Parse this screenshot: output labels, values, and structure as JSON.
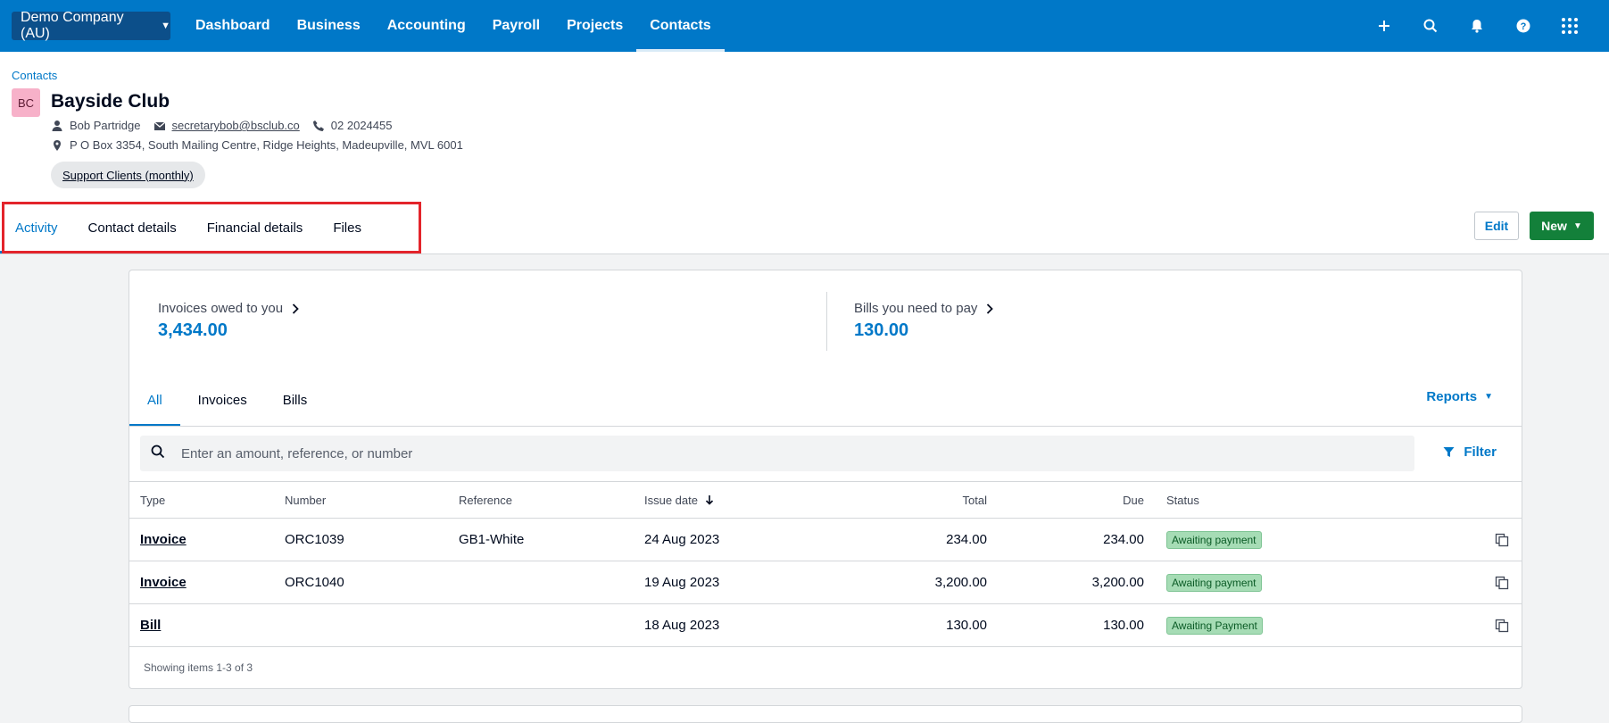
{
  "topbar": {
    "org_name": "Demo Company (AU)",
    "nav": [
      "Dashboard",
      "Business",
      "Accounting",
      "Payroll",
      "Projects",
      "Contacts"
    ],
    "active_nav": "Contacts",
    "icons": [
      "plus-icon",
      "search-icon",
      "bell-icon",
      "help-icon",
      "apps-grid-icon"
    ]
  },
  "header": {
    "breadcrumb": "Contacts",
    "avatar_initials": "BC",
    "contact_name": "Bayside Club",
    "person": "Bob Partridge",
    "email": "secretarybob@bsclub.co",
    "phone": "02 2024455",
    "address": "P O Box 3354, South Mailing Centre, Ridge Heights, Madeupville, MVL 6001",
    "group": "Support Clients (monthly)",
    "tabs": [
      "Activity",
      "Contact details",
      "Financial details",
      "Files"
    ],
    "active_tab": "Activity",
    "edit_label": "Edit",
    "new_label": "New"
  },
  "summary": {
    "owed_label": "Invoices owed to you",
    "owed_value": "3,434.00",
    "bills_label": "Bills you need to pay",
    "bills_value": "130.00"
  },
  "activity": {
    "subtabs": [
      "All",
      "Invoices",
      "Bills"
    ],
    "active_subtab": "All",
    "reports_label": "Reports",
    "search_placeholder": "Enter an amount, reference, or number",
    "filter_label": "Filter",
    "columns": {
      "type": "Type",
      "number": "Number",
      "reference": "Reference",
      "issue_date": "Issue date",
      "total": "Total",
      "due": "Due",
      "status": "Status"
    },
    "rows": [
      {
        "type": "Invoice",
        "number": "ORC1039",
        "reference": "GB1-White",
        "issue_date": "24 Aug 2023",
        "total": "234.00",
        "due": "234.00",
        "status": "Awaiting payment"
      },
      {
        "type": "Invoice",
        "number": "ORC1040",
        "reference": "",
        "issue_date": "19 Aug 2023",
        "total": "3,200.00",
        "due": "3,200.00",
        "status": "Awaiting payment"
      },
      {
        "type": "Bill",
        "number": "",
        "reference": "",
        "issue_date": "18 Aug 2023",
        "total": "130.00",
        "due": "130.00",
        "status": "Awaiting Payment"
      }
    ],
    "showing": "Showing items 1-3 of 3"
  },
  "colors": {
    "brand_blue": "#0078c8",
    "new_button_green": "#13803a",
    "status_badge_green": "#a6dcb5",
    "highlight_red": "#e3242b"
  }
}
